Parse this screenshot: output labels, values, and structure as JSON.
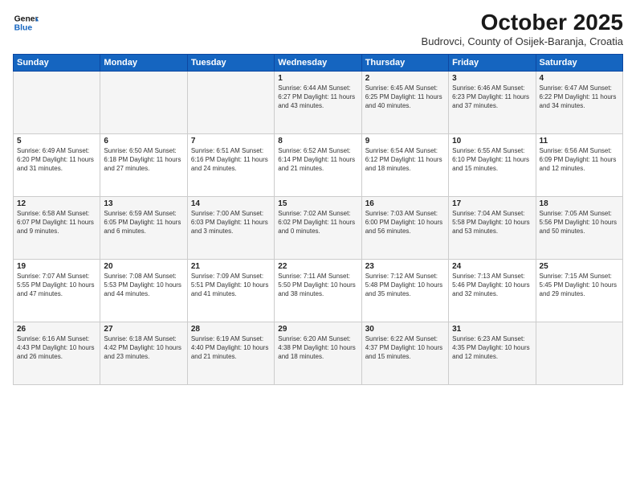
{
  "header": {
    "logo_line1": "General",
    "logo_line2": "Blue",
    "month_year": "October 2025",
    "location": "Budrovci, County of Osijek-Baranja, Croatia"
  },
  "days_of_week": [
    "Sunday",
    "Monday",
    "Tuesday",
    "Wednesday",
    "Thursday",
    "Friday",
    "Saturday"
  ],
  "weeks": [
    [
      {
        "date": "",
        "info": ""
      },
      {
        "date": "",
        "info": ""
      },
      {
        "date": "",
        "info": ""
      },
      {
        "date": "1",
        "info": "Sunrise: 6:44 AM\nSunset: 6:27 PM\nDaylight: 11 hours\nand 43 minutes."
      },
      {
        "date": "2",
        "info": "Sunrise: 6:45 AM\nSunset: 6:25 PM\nDaylight: 11 hours\nand 40 minutes."
      },
      {
        "date": "3",
        "info": "Sunrise: 6:46 AM\nSunset: 6:23 PM\nDaylight: 11 hours\nand 37 minutes."
      },
      {
        "date": "4",
        "info": "Sunrise: 6:47 AM\nSunset: 6:22 PM\nDaylight: 11 hours\nand 34 minutes."
      }
    ],
    [
      {
        "date": "5",
        "info": "Sunrise: 6:49 AM\nSunset: 6:20 PM\nDaylight: 11 hours\nand 31 minutes."
      },
      {
        "date": "6",
        "info": "Sunrise: 6:50 AM\nSunset: 6:18 PM\nDaylight: 11 hours\nand 27 minutes."
      },
      {
        "date": "7",
        "info": "Sunrise: 6:51 AM\nSunset: 6:16 PM\nDaylight: 11 hours\nand 24 minutes."
      },
      {
        "date": "8",
        "info": "Sunrise: 6:52 AM\nSunset: 6:14 PM\nDaylight: 11 hours\nand 21 minutes."
      },
      {
        "date": "9",
        "info": "Sunrise: 6:54 AM\nSunset: 6:12 PM\nDaylight: 11 hours\nand 18 minutes."
      },
      {
        "date": "10",
        "info": "Sunrise: 6:55 AM\nSunset: 6:10 PM\nDaylight: 11 hours\nand 15 minutes."
      },
      {
        "date": "11",
        "info": "Sunrise: 6:56 AM\nSunset: 6:09 PM\nDaylight: 11 hours\nand 12 minutes."
      }
    ],
    [
      {
        "date": "12",
        "info": "Sunrise: 6:58 AM\nSunset: 6:07 PM\nDaylight: 11 hours\nand 9 minutes."
      },
      {
        "date": "13",
        "info": "Sunrise: 6:59 AM\nSunset: 6:05 PM\nDaylight: 11 hours\nand 6 minutes."
      },
      {
        "date": "14",
        "info": "Sunrise: 7:00 AM\nSunset: 6:03 PM\nDaylight: 11 hours\nand 3 minutes."
      },
      {
        "date": "15",
        "info": "Sunrise: 7:02 AM\nSunset: 6:02 PM\nDaylight: 11 hours\nand 0 minutes."
      },
      {
        "date": "16",
        "info": "Sunrise: 7:03 AM\nSunset: 6:00 PM\nDaylight: 10 hours\nand 56 minutes."
      },
      {
        "date": "17",
        "info": "Sunrise: 7:04 AM\nSunset: 5:58 PM\nDaylight: 10 hours\nand 53 minutes."
      },
      {
        "date": "18",
        "info": "Sunrise: 7:05 AM\nSunset: 5:56 PM\nDaylight: 10 hours\nand 50 minutes."
      }
    ],
    [
      {
        "date": "19",
        "info": "Sunrise: 7:07 AM\nSunset: 5:55 PM\nDaylight: 10 hours\nand 47 minutes."
      },
      {
        "date": "20",
        "info": "Sunrise: 7:08 AM\nSunset: 5:53 PM\nDaylight: 10 hours\nand 44 minutes."
      },
      {
        "date": "21",
        "info": "Sunrise: 7:09 AM\nSunset: 5:51 PM\nDaylight: 10 hours\nand 41 minutes."
      },
      {
        "date": "22",
        "info": "Sunrise: 7:11 AM\nSunset: 5:50 PM\nDaylight: 10 hours\nand 38 minutes."
      },
      {
        "date": "23",
        "info": "Sunrise: 7:12 AM\nSunset: 5:48 PM\nDaylight: 10 hours\nand 35 minutes."
      },
      {
        "date": "24",
        "info": "Sunrise: 7:13 AM\nSunset: 5:46 PM\nDaylight: 10 hours\nand 32 minutes."
      },
      {
        "date": "25",
        "info": "Sunrise: 7:15 AM\nSunset: 5:45 PM\nDaylight: 10 hours\nand 29 minutes."
      }
    ],
    [
      {
        "date": "26",
        "info": "Sunrise: 6:16 AM\nSunset: 4:43 PM\nDaylight: 10 hours\nand 26 minutes."
      },
      {
        "date": "27",
        "info": "Sunrise: 6:18 AM\nSunset: 4:42 PM\nDaylight: 10 hours\nand 23 minutes."
      },
      {
        "date": "28",
        "info": "Sunrise: 6:19 AM\nSunset: 4:40 PM\nDaylight: 10 hours\nand 21 minutes."
      },
      {
        "date": "29",
        "info": "Sunrise: 6:20 AM\nSunset: 4:38 PM\nDaylight: 10 hours\nand 18 minutes."
      },
      {
        "date": "30",
        "info": "Sunrise: 6:22 AM\nSunset: 4:37 PM\nDaylight: 10 hours\nand 15 minutes."
      },
      {
        "date": "31",
        "info": "Sunrise: 6:23 AM\nSunset: 4:35 PM\nDaylight: 10 hours\nand 12 minutes."
      },
      {
        "date": "",
        "info": ""
      }
    ]
  ]
}
